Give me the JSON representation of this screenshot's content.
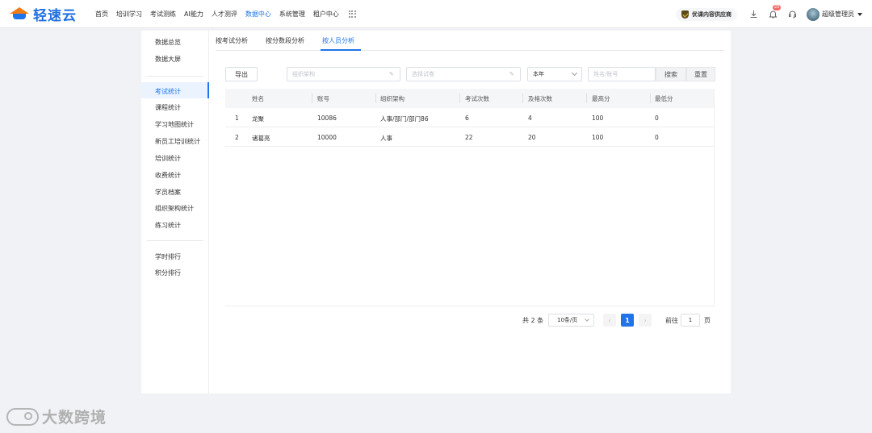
{
  "brand": {
    "name": "轻速云"
  },
  "topnav": {
    "items": [
      "首页",
      "培训学习",
      "考试测练",
      "AI能力",
      "人才测评",
      "数据中心",
      "系统管理",
      "租户中心"
    ],
    "active_index": 5
  },
  "header": {
    "vendor_chip": "优课内容供应商",
    "notification_count": "25",
    "user_name": "超级管理员"
  },
  "sidebar": {
    "group1": [
      "数据总览",
      "数据大屏"
    ],
    "group2": [
      "考试统计",
      "课程统计",
      "学习地图统计",
      "新员工培训统计",
      "培训统计",
      "收费统计",
      "学员档案",
      "组织架构统计",
      "练习统计"
    ],
    "group3": [
      "学时排行",
      "积分排行"
    ],
    "active": "考试统计"
  },
  "tabs": {
    "items": [
      "按考试分析",
      "按分数段分析",
      "按人员分析"
    ],
    "active_index": 2
  },
  "toolbar": {
    "export_label": "导出",
    "org_placeholder": "组织架构",
    "exam_placeholder": "选择试卷",
    "period_value": "本年",
    "search_placeholder": "姓名/账号",
    "search_label": "搜索",
    "reset_label": "重置"
  },
  "table": {
    "columns": [
      "姓名",
      "账号",
      "组织架构",
      "考试次数",
      "及格次数",
      "最高分",
      "最低分"
    ],
    "rows": [
      {
        "index": "1",
        "name": "龙聚",
        "account": "10086",
        "org": "人事/部门/部门86",
        "exams": "6",
        "passed": "4",
        "max": "100",
        "min": "0"
      },
      {
        "index": "2",
        "name": "诸葛亮",
        "account": "10000",
        "org": "人事",
        "exams": "22",
        "passed": "20",
        "max": "100",
        "min": "0"
      }
    ]
  },
  "pagination": {
    "total_text": "共 2 条",
    "page_size": "10条/页",
    "prev": "‹",
    "current": "1",
    "next": "›",
    "goto_label": "前往",
    "goto_value": "1",
    "goto_unit": "页"
  },
  "watermark": {
    "text": "大数跨境"
  },
  "colors": {
    "accent": "#1e74e8",
    "brand_orange": "#f07c1a",
    "badge": "#f56c6c"
  }
}
